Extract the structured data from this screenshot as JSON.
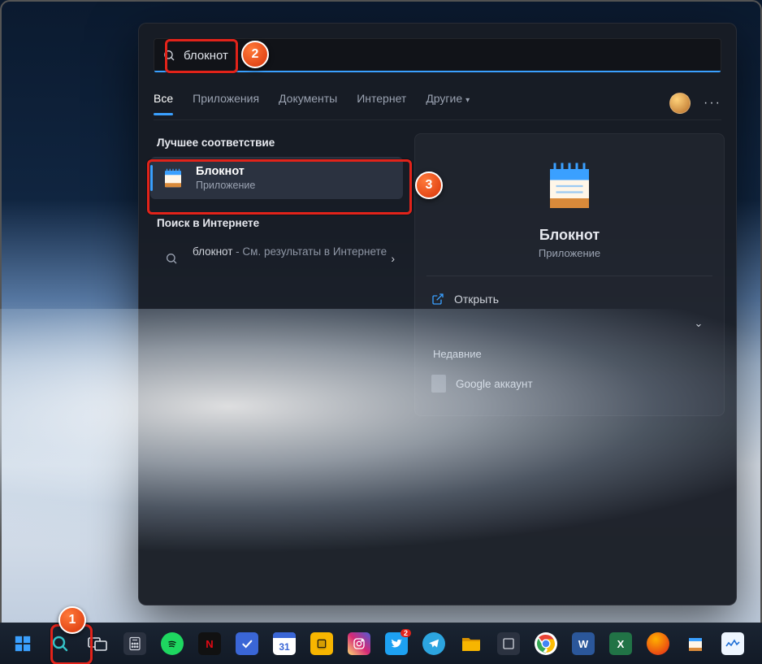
{
  "search": {
    "value": "блокнот"
  },
  "tabs": {
    "all": "Все",
    "apps": "Приложения",
    "docs": "Документы",
    "web": "Интернет",
    "more": "Другие"
  },
  "sections": {
    "best": "Лучшее соответствие",
    "web": "Поиск в Интернете"
  },
  "best_match": {
    "title": "Блокнот",
    "subtitle": "Приложение"
  },
  "web_result": {
    "term": "блокнот",
    "suffix": " - См. результаты в Интернете"
  },
  "preview": {
    "title": "Блокнот",
    "subtitle": "Приложение",
    "open": "Открыть",
    "recent_label": "Недавние",
    "recent_item": "Google аккаунт"
  },
  "markers": {
    "m1": "1",
    "m2": "2",
    "m3": "3"
  },
  "taskbar_icons": [
    "start-icon",
    "search-icon",
    "taskview-icon",
    "calculator-icon",
    "spotify-icon",
    "netflix-icon",
    "todo-icon",
    "calendar-icon",
    "files-icon",
    "instagram-icon",
    "twitter-icon",
    "telegram-icon",
    "explorer-icon",
    "shortcut-icon",
    "chrome-icon",
    "word-icon",
    "excel-icon",
    "opera-icon",
    "notepad-icon",
    "taskmgr-icon"
  ]
}
